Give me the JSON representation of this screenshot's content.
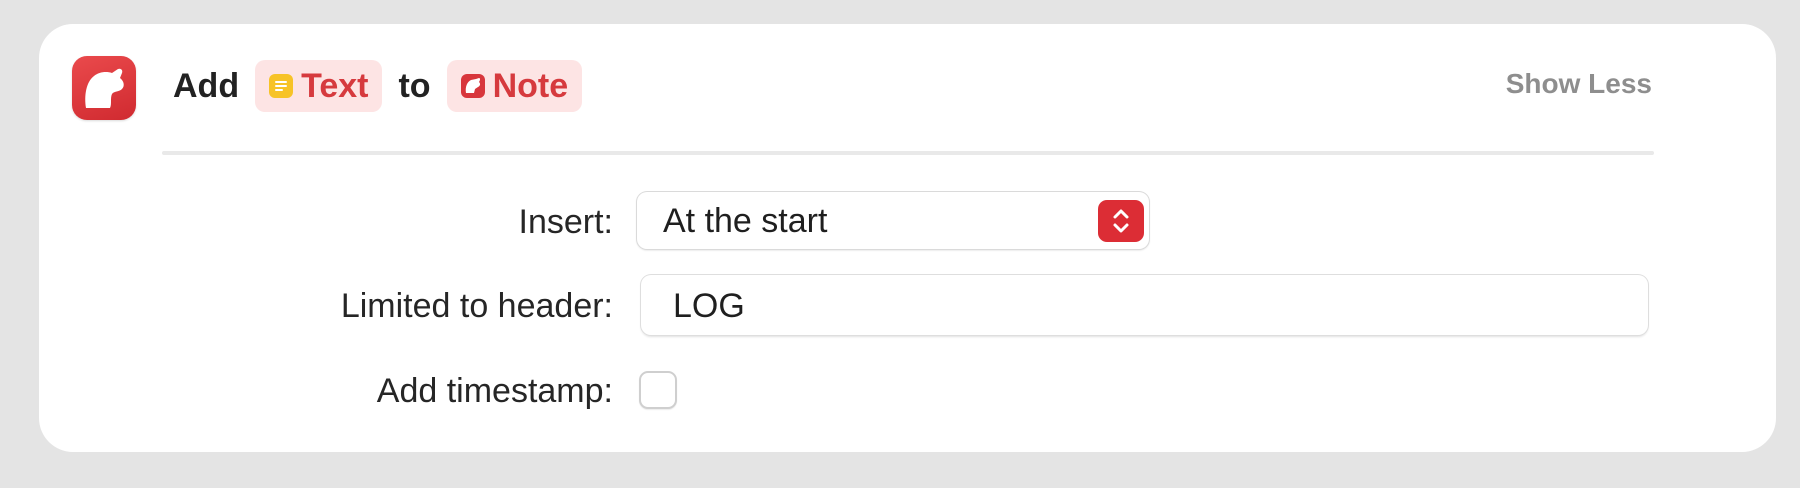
{
  "action": {
    "app_icon": "bear-app-icon",
    "verb": "Add",
    "input_token": {
      "label": "Text",
      "icon": "text-variable-icon",
      "icon_color": "#f7c327"
    },
    "connector": "to",
    "target_token": {
      "label": "Note",
      "icon": "bear-note-icon",
      "icon_color": "#d8363c"
    },
    "show_less_label": "Show Less"
  },
  "params": {
    "insert": {
      "label": "Insert:",
      "value": "At the start"
    },
    "header": {
      "label": "Limited to header:",
      "value": "LOG"
    },
    "timestamp": {
      "label": "Add timestamp:",
      "checked": false
    }
  },
  "colors": {
    "accent": "#dc2d35",
    "token_background": "#fde4e4",
    "token_text": "#d63a3e",
    "card_background": "#ffffff",
    "page_background": "#e4e4e4"
  }
}
